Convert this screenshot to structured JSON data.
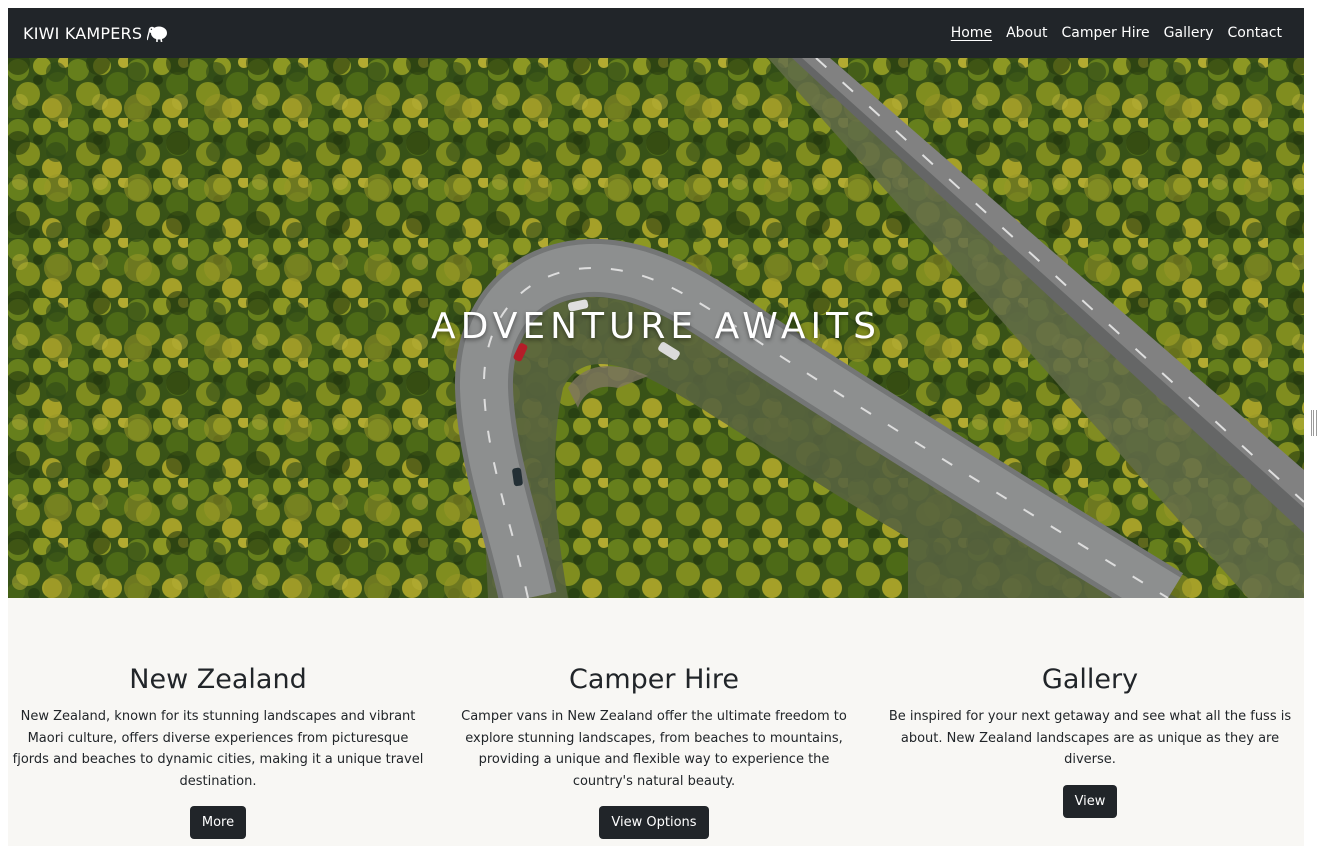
{
  "navbar": {
    "brand": "KIWI KAMPERS",
    "brand_icon": "kiwi-bird-icon",
    "links": [
      {
        "label": "Home",
        "active": true
      },
      {
        "label": "About",
        "active": false
      },
      {
        "label": "Camper Hire",
        "active": false
      },
      {
        "label": "Gallery",
        "active": false
      },
      {
        "label": "Contact",
        "active": false
      }
    ]
  },
  "hero": {
    "title": "ADVENTURE AWAITS"
  },
  "cards": [
    {
      "title": "New Zealand",
      "text": "New Zealand, known for its stunning landscapes and vibrant Maori culture, offers diverse experiences from picturesque fjords and beaches to dynamic cities, making it a unique travel destination.",
      "button": "More"
    },
    {
      "title": "Camper Hire",
      "text": "Camper vans in New Zealand offer the ultimate freedom to explore stunning landscapes, from beaches to mountains, providing a unique and flexible way to experience the country's natural beauty.",
      "button": "View Options"
    },
    {
      "title": "Gallery",
      "text": "Be inspired for your next getaway and see what all the fuss is about. New Zealand landscapes are as unique as they are diverse.",
      "button": "View"
    }
  ],
  "colors": {
    "navbar_bg": "#212529",
    "page_bg": "#f8f7f4",
    "button_bg": "#212529",
    "hero_text": "#ffffff"
  }
}
